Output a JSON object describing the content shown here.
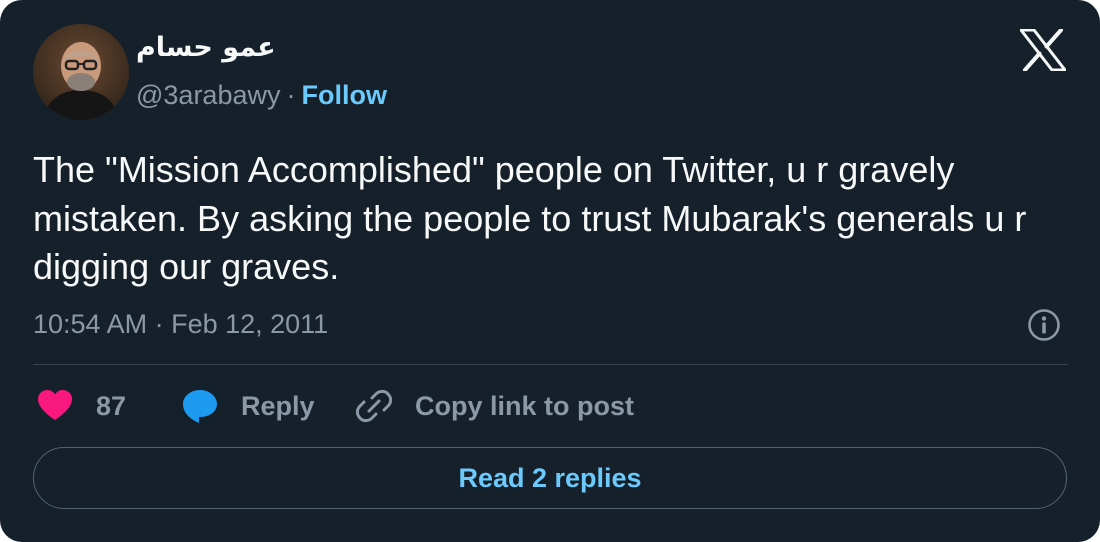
{
  "author": {
    "display_name": "عمو حسام",
    "handle": "@3arabawy",
    "separator": "·",
    "follow_label": "Follow"
  },
  "tweet": {
    "text": "The \"Mission Accomplished\" people on Twitter, u r gravely mistaken. By asking the people to trust Mubarak's generals u r digging our graves.",
    "timestamp": "10:54 AM · Feb 12, 2011"
  },
  "actions": {
    "like_count": "87",
    "reply_label": "Reply",
    "copy_link_label": "Copy link to post"
  },
  "footer": {
    "read_replies_label": "Read 2 replies"
  },
  "icons": {
    "brand": "x-logo-icon",
    "info": "info-icon",
    "like": "heart-icon",
    "reply": "speech-bubble-icon",
    "copy": "link-icon"
  },
  "colors": {
    "background": "#15202b",
    "text": "#f7f9f9",
    "secondary_text": "#8b98a5",
    "accent": "#6bc9fb",
    "like": "#f91880",
    "reply": "#1d9bf0",
    "divider": "#38444d"
  }
}
